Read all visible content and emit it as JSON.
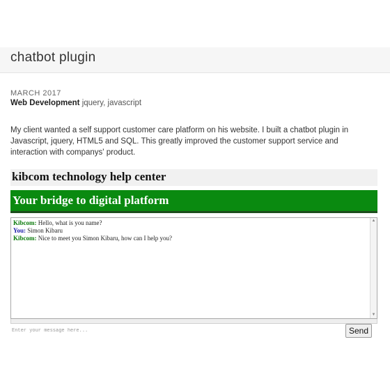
{
  "post": {
    "title": "chatbot plugin",
    "date": "MARCH 2017",
    "category": "Web Development",
    "tags": "jquery, javascript",
    "description": "My client wanted a self support customer care platform on his website. I built a chatbot plugin in Javascript, jquery, HTML5 and SQL. This greatly improved the customer support service and interaction with companys' product."
  },
  "chat_widget": {
    "header": "kibcom technology help center",
    "banner": "Your bridge to digital platform",
    "banner_color": "#0a8a10",
    "messages": [
      {
        "sender": "Kibcom:",
        "text": " Hello, what is you name?",
        "sender_color": "#0a7a0a"
      },
      {
        "sender": "You:",
        "text": " Simon Kibaru",
        "sender_color": "#1a1aa8"
      },
      {
        "sender": "Kibcom:",
        "text": " Nice to meet you Simon Kibaru, how can I help you?",
        "sender_color": "#0a7a0a"
      }
    ],
    "input_placeholder": "Enter your message here...",
    "send_label": "Send"
  }
}
